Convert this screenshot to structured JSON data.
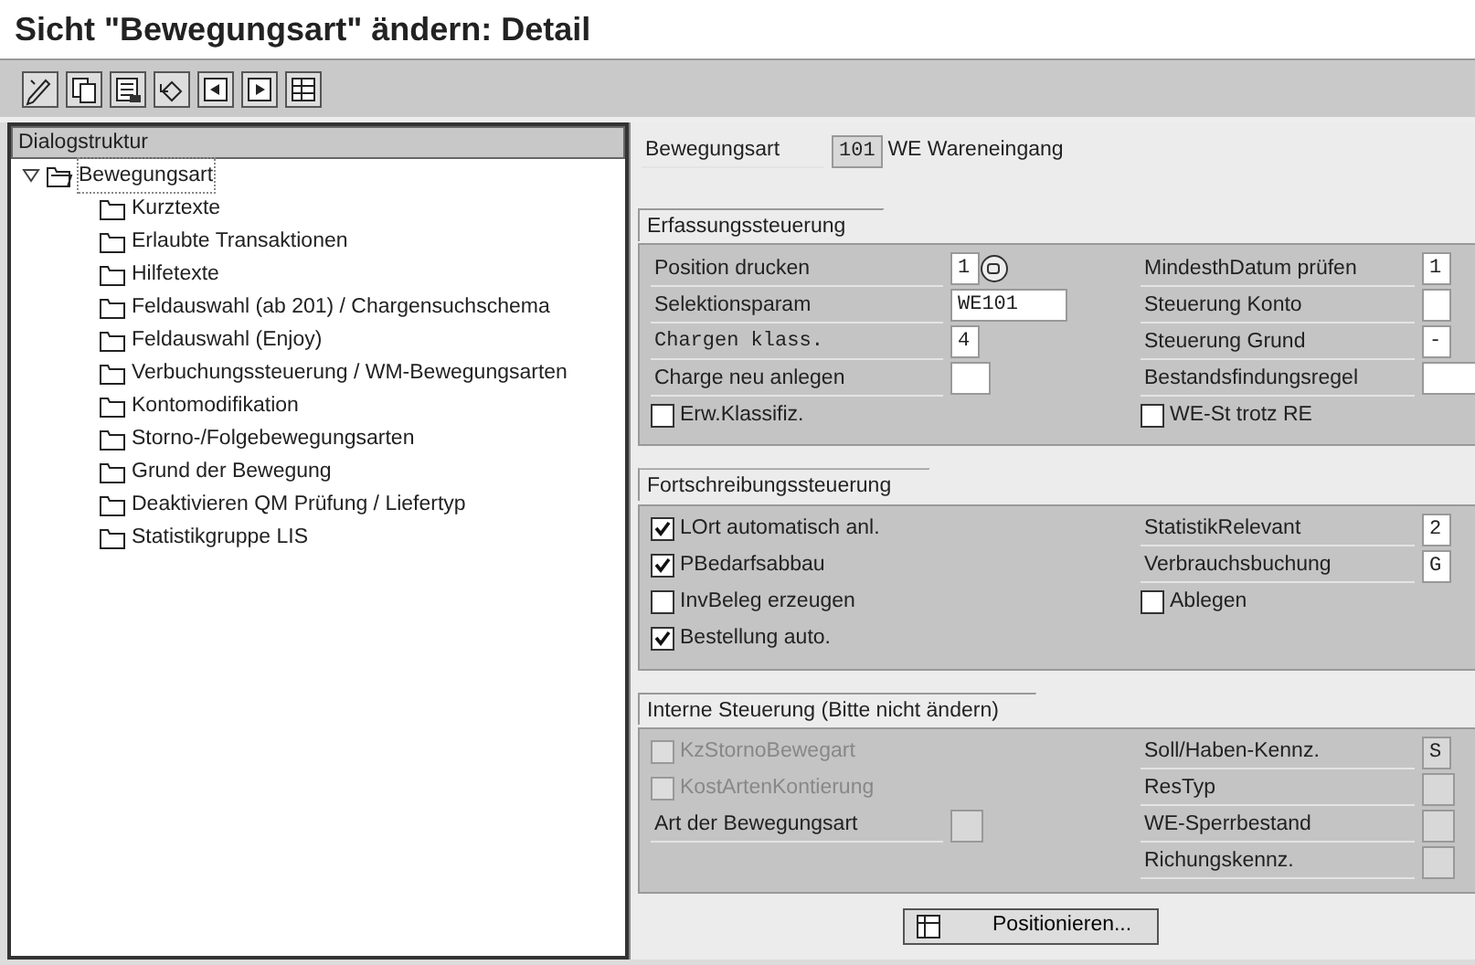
{
  "window": {
    "title": "Sicht \"Bewegungsart\" ändern: Detail"
  },
  "dialog_structure": {
    "header": "Dialogstruktur",
    "root": {
      "label": "Bewegungsart",
      "expanded": true,
      "selected": true,
      "children": [
        {
          "label": "Kurztexte"
        },
        {
          "label": "Erlaubte Transaktionen"
        },
        {
          "label": "Hilfetexte"
        },
        {
          "label": "Feldauswahl (ab 201) / Chargensuchschema"
        },
        {
          "label": "Feldauswahl (Enjoy)"
        },
        {
          "label": "Verbuchungssteuerung / WM-Bewegungsarten"
        },
        {
          "label": "Kontomodifikation"
        },
        {
          "label": "Storno-/Folgebewegungsarten"
        },
        {
          "label": "Grund der Bewegung"
        },
        {
          "label": "Deaktivieren QM Prüfung / Liefertyp"
        },
        {
          "label": "Statistikgruppe LIS"
        }
      ]
    }
  },
  "header_field": {
    "label": "Bewegungsart",
    "value": "101",
    "disabled": true,
    "description": "WE Wareneingang"
  },
  "groups": [
    {
      "title": "Erfassungssteuerung",
      "left": [
        {
          "kind": "select",
          "label": "Position drucken",
          "value": "1",
          "disabled": false
        },
        {
          "kind": "field",
          "label": "Selektionsparam",
          "value": "WE101",
          "disabled": false
        },
        {
          "kind": "field",
          "label": "Chargen klass.",
          "value": "4",
          "disabled": false,
          "monospace": true
        },
        {
          "kind": "field",
          "label": "Charge neu anlegen",
          "disabled": false
        },
        {
          "kind": "checkbox",
          "label": "Erw.Klassifiz.",
          "checked": false,
          "disabled": false
        }
      ],
      "right": [
        {
          "kind": "field",
          "label": "MindesthDatum prüfen",
          "value": "1",
          "disabled": false
        },
        {
          "kind": "field",
          "label": "Steuerung Konto",
          "disabled": false
        },
        {
          "kind": "field",
          "label": "Steuerung Grund",
          "value": "-",
          "disabled": false
        },
        {
          "kind": "field",
          "label": "Bestandsfindungsregel",
          "disabled": false
        },
        {
          "kind": "checkbox",
          "label": "WE-St trotz RE",
          "checked": false,
          "disabled": false
        }
      ]
    },
    {
      "title": "Fortschreibungssteuerung",
      "left": [
        {
          "kind": "checkbox",
          "label": "LOrt automatisch anl.",
          "checked": true,
          "disabled": false
        },
        {
          "kind": "checkbox",
          "label": "PBedarfsabbau",
          "checked": true,
          "disabled": false
        },
        {
          "kind": "checkbox",
          "label": "InvBeleg erzeugen",
          "checked": false,
          "disabled": false
        },
        {
          "kind": "checkbox",
          "label": "Bestellung auto.",
          "checked": true,
          "disabled": false
        }
      ],
      "right": [
        {
          "kind": "field",
          "label": "StatistikRelevant",
          "value": "2",
          "disabled": false
        },
        {
          "kind": "field",
          "label": "Verbrauchsbuchung",
          "value": "G",
          "disabled": false
        },
        {
          "kind": "checkbox",
          "label": "Ablegen",
          "checked": false,
          "disabled": false
        }
      ]
    },
    {
      "title": "Interne Steuerung (Bitte nicht ändern)",
      "left": [
        {
          "kind": "checkbox",
          "label": "KzStornoBewegart",
          "checked": false,
          "disabled": true
        },
        {
          "kind": "checkbox",
          "label": "KostArtenKontierung",
          "checked": false,
          "disabled": true
        },
        {
          "kind": "field",
          "label": "Art der Bewegungsart",
          "disabled": true
        }
      ],
      "right": [
        {
          "kind": "field",
          "label": "Soll/Haben-Kennz.",
          "value": "S",
          "disabled": true
        },
        {
          "kind": "field",
          "label": "ResTyp",
          "disabled": true
        },
        {
          "kind": "field",
          "label": "WE-Sperrbestand",
          "disabled": true
        },
        {
          "kind": "field",
          "label": "Richungskennz.",
          "disabled": true
        }
      ]
    }
  ],
  "footer_button": {
    "label": "Positionieren..."
  }
}
